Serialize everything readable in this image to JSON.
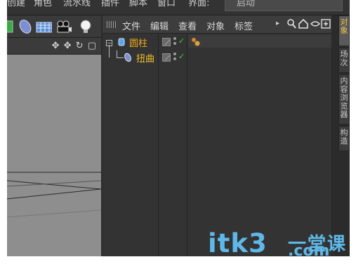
{
  "menubar": {
    "items": [
      "创建",
      "角色",
      "流水线",
      "插件",
      "脚本",
      "窗口",
      "界面:"
    ],
    "layout_value": "启动"
  },
  "viewport": {
    "toolbar_icons": [
      "cube-icon",
      "deformer-icon",
      "floor-icon",
      "camera-icon",
      "light-icon"
    ],
    "nav_icons": "✥ ✥ ↻ ▢"
  },
  "object_manager": {
    "menu": [
      "文件",
      "编辑",
      "查看",
      "对象",
      "标签"
    ],
    "menu_more": "▸",
    "icons": [
      "search-icon",
      "home-icon",
      "eye-icon",
      "new-window-icon"
    ],
    "objects": [
      {
        "name": "圆柱",
        "type": "cylinder",
        "level": 0,
        "expanded": true,
        "tag": "phong"
      },
      {
        "name": "扭曲",
        "type": "twist",
        "level": 1,
        "expanded": false,
        "tag": ""
      }
    ]
  },
  "side_tabs": [
    {
      "label": "对象",
      "active": true
    },
    {
      "label": "场次",
      "active": false
    },
    {
      "label": "内容浏览器",
      "active": false
    },
    {
      "label": "构造",
      "active": false
    }
  ],
  "watermark": {
    "latin": "itk3",
    "cn": "一堂课",
    "com": ".com"
  },
  "colors": {
    "object_label": "#f1a81b",
    "checkmark": "#37d24a",
    "watermark": "#5fb8e8"
  }
}
